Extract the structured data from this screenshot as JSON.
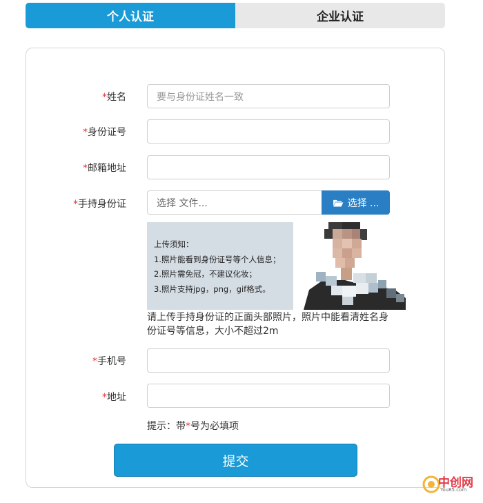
{
  "tabs": {
    "personal": "个人认证",
    "enterprise": "企业认证"
  },
  "form": {
    "name_label": "姓名",
    "name_placeholder": "要与身份证姓名一致",
    "idcard_label": "身份证号",
    "email_label": "邮箱地址",
    "handheld_label": "手持身份证",
    "file_placeholder": "选择 文件...",
    "file_button": "选择 ...",
    "phone_label": "手机号",
    "address_label": "地址",
    "required_mark": "*"
  },
  "notice": {
    "title": "上传须知：",
    "line1": "1.照片能看到身份证号等个人信息；",
    "line2": "2.照片需免冠，不建议化妆；",
    "line3": "3.照片支持jpg，png，gif格式。"
  },
  "upload_hint": "请上传手持身份证的正面头部照片，照片中能看清姓名身份证号等信息，大小不超过2m",
  "tip": {
    "prefix": "提示：带",
    "star": "*",
    "suffix": "号为必填项"
  },
  "submit_label": "提交",
  "watermark": {
    "text": "中创网",
    "sub": "You85.com"
  },
  "colors": {
    "primary": "#1a9ad6",
    "file_button": "#2a7fc4",
    "required": "#e03a3a",
    "tab_inactive": "#e8e8e8"
  }
}
